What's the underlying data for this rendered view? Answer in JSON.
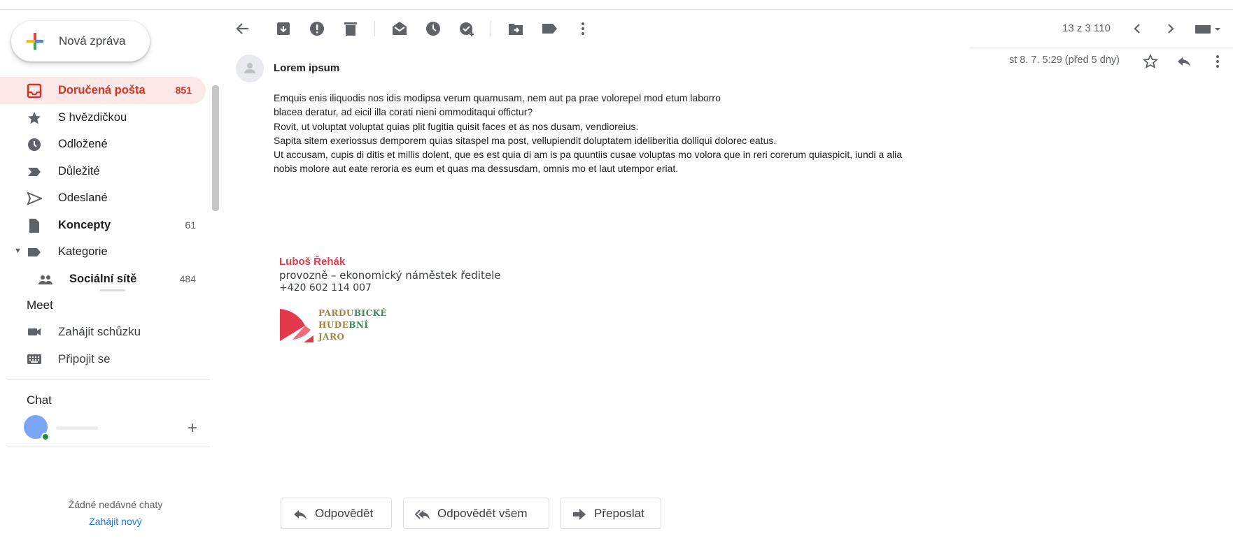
{
  "compose": {
    "label": "Nová zpráva"
  },
  "sidebar": {
    "items": [
      {
        "label": "Doručená pošta",
        "count": "851",
        "icon": "inbox-icon"
      },
      {
        "label": "S hvězdičkou",
        "count": "",
        "icon": "star-icon"
      },
      {
        "label": "Odložené",
        "count": "",
        "icon": "clock-icon"
      },
      {
        "label": "Důležité",
        "count": "",
        "icon": "important-icon"
      },
      {
        "label": "Odeslané",
        "count": "",
        "icon": "send-icon"
      },
      {
        "label": "Koncepty",
        "count": "61",
        "icon": "draft-icon"
      },
      {
        "label": "Kategorie",
        "count": "",
        "icon": "label-icon"
      },
      {
        "label": "Sociální sítě",
        "count": "484",
        "icon": "people-icon"
      }
    ]
  },
  "meet": {
    "title": "Meet",
    "start": "Zahájit schůzku",
    "join": "Připojit se"
  },
  "chat": {
    "title": "Chat",
    "empty": "Žádné nedávné chaty",
    "start_new": "Zahájit nový"
  },
  "toolbar": {
    "pager": "13 z 3 110"
  },
  "message": {
    "sender": "Lorem ipsum",
    "date": "st 8. 7. 5:29 (před 5 dny)",
    "body": [
      "Emquis enis iliquodis nos idis modipsa verum quamusam, nem aut pa prae volorepel mod etum laborro",
      "blacea deratur, ad eicil illa corati nieni ommoditaqui offictur?",
      "Rovit, ut voluptat voluptat quias plit fugitia quisit faces et as nos dusam, vendioreius.",
      "Sapita sitem exeriossus demporem quias sitaspel ma post, vellupiendit doluptatem ideliberitia dolliqui dolorec eatus.",
      "Ut accusam, cupis di ditis et millis dolent, que es est quia di am is pa quuntiis cusae voluptas mo volora que in reri corerum quiaspicit, iundi a alia",
      "nobis molore aut eate reroria es eum et quas ma dessusdam, omnis mo et laut utempor eriat."
    ],
    "signature": {
      "name": "Luboš Řehák",
      "role": "provozně – ekonomický náměstek ředitele",
      "phone": "+420 602 114 007",
      "logo_line1_a": "PARDU",
      "logo_line1_b": "BICKÉ",
      "logo_line2_a": "HUDE",
      "logo_line2_b": "BNÍ",
      "logo_line3": "JARO"
    }
  },
  "actions": {
    "reply": "Odpovědět",
    "reply_all": "Odpovědět všem",
    "forward": "Přeposlat"
  },
  "colors": {
    "accent_red": "#d93025",
    "active_bg": "#fce8e6",
    "link_blue": "#1a73e8",
    "signature_red": "#e2394b"
  }
}
